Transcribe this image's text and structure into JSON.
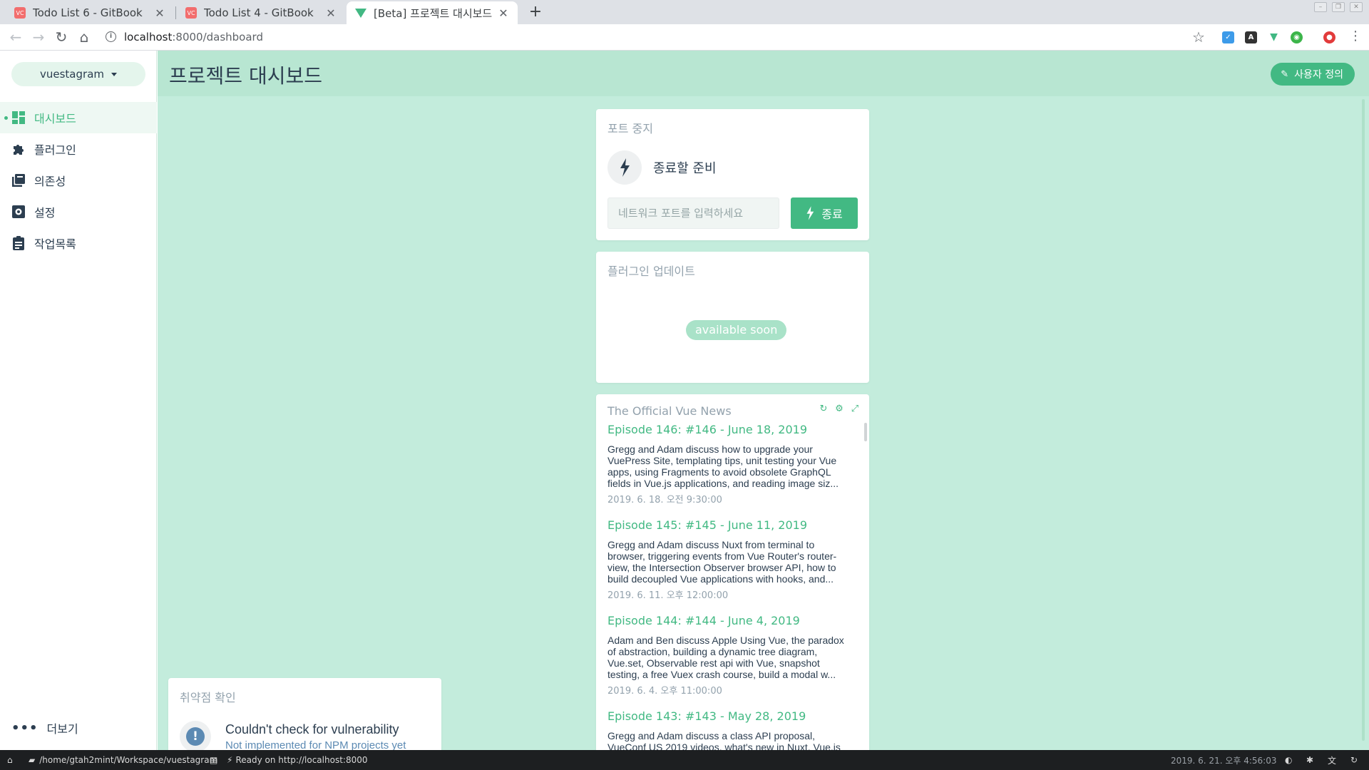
{
  "browser": {
    "tabs": [
      {
        "title": "Todo List 6 - GitBook",
        "favicon": "gitbook-icon"
      },
      {
        "title": "Todo List 4 - GitBook",
        "favicon": "gitbook-icon"
      },
      {
        "title": "[Beta] 프로젝트 대시보드 -",
        "favicon": "vue-icon"
      }
    ],
    "url_host": "localhost",
    "url_path": ":8000/dashboard"
  },
  "sidebar": {
    "project": "vuestagram",
    "items": [
      {
        "label": "대시보드",
        "icon": "dashboard-icon"
      },
      {
        "label": "플러그인",
        "icon": "puzzle-icon"
      },
      {
        "label": "의존성",
        "icon": "library-icon"
      },
      {
        "label": "설정",
        "icon": "gear-icon"
      },
      {
        "label": "작업목록",
        "icon": "clipboard-icon"
      }
    ],
    "more_label": "더보기"
  },
  "header": {
    "title": "프로젝트 대시보드",
    "customize_label": "사용자 정의"
  },
  "kill_port": {
    "title": "포트 중지",
    "status": "종료할 준비",
    "placeholder": "네트워크 포트를 입력하세요",
    "button": "종료"
  },
  "plugin_updates": {
    "title": "플러그인 업데이트",
    "badge": "available soon"
  },
  "vue_news": {
    "title": "The Official Vue News",
    "items": [
      {
        "title": "Episode 146: #146 - June 18, 2019",
        "desc": "Gregg and Adam discuss how to upgrade your VuePress Site, templating tips, unit testing your Vue apps, using Fragments to avoid obsolete GraphQL fields in Vue.js applications, and reading image siz...",
        "date": "2019. 6. 18. 오전 9:30:00"
      },
      {
        "title": "Episode 145: #145 - June 11, 2019",
        "desc": "Gregg and Adam discuss Nuxt from terminal to browser, triggering events from Vue Router's router-view, the Intersection Observer browser API, how to build decoupled Vue applications with hooks, and...",
        "date": "2019. 6. 11. 오후 12:00:00"
      },
      {
        "title": "Episode 144: #144 - June 4, 2019",
        "desc": "Adam and Ben discuss Apple Using Vue, the paradox of abstraction, building a dynamic tree diagram, Vue.set, Observable rest api with Vue, snapshot testing, a free Vuex crash course, build a modal w...",
        "date": "2019. 6. 4. 오후 11:00:00"
      },
      {
        "title": "Episode 143: #143 - May 28, 2019",
        "desc": "Gregg and Adam discuss a class API proposal, VueConf US 2019 videos, what's new in Nuxt, Vue.js",
        "date": ""
      }
    ]
  },
  "vulnerability": {
    "title": "취약점 확인",
    "status": "Couldn't check for vulnerability",
    "sub": "Not implemented for NPM projects yet"
  },
  "statusbar": {
    "path": "/home/gtah2mint/Workspace/vuestagram",
    "ready": "Ready on http://localhost:8000",
    "datetime": "2019. 6. 21. 오후 4:56:03"
  },
  "colors": {
    "accent": "#42b983",
    "main_bg": "#c3ecdc",
    "header_bg": "#b8e6d2",
    "statusbar_bg": "#1d1f21"
  }
}
